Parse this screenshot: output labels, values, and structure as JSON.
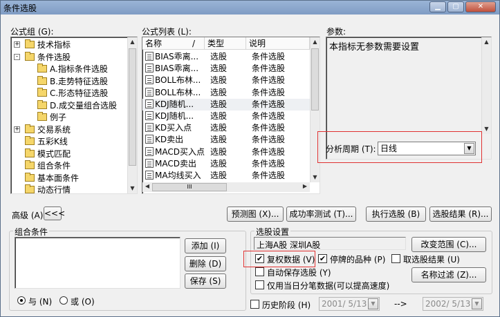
{
  "window": {
    "title": "条件选股"
  },
  "formula_group": {
    "label": "公式组 (G):",
    "tree": [
      {
        "label": "技术指标",
        "level": 0,
        "expander": "+"
      },
      {
        "label": "条件选股",
        "level": 0,
        "expander": "-"
      },
      {
        "label": "A.指标条件选股",
        "level": 1,
        "open": true
      },
      {
        "label": "B.走势特征选股",
        "level": 1
      },
      {
        "label": "C.形态特征选股",
        "level": 1
      },
      {
        "label": "D.成交量组合选股",
        "level": 1
      },
      {
        "label": "例子",
        "level": 1
      },
      {
        "label": "交易系统",
        "level": 0,
        "expander": "+"
      },
      {
        "label": "五彩K线",
        "level": 0
      },
      {
        "label": "模式匹配",
        "level": 0
      },
      {
        "label": "组合条件",
        "level": 0
      },
      {
        "label": "基本面条件",
        "level": 0
      },
      {
        "label": "动态行情",
        "level": 0
      }
    ]
  },
  "formula_list": {
    "label": "公式列表 (L):",
    "columns": {
      "name": "名称",
      "sep": "/",
      "type": "类型",
      "desc": "说明"
    },
    "rows": [
      {
        "name": "BIAS乖离...",
        "type": "选股",
        "desc": "条件选股"
      },
      {
        "name": "BIAS乖离...",
        "type": "选股",
        "desc": "条件选股"
      },
      {
        "name": "BOLL布林...",
        "type": "选股",
        "desc": "条件选股"
      },
      {
        "name": "BOLL布林...",
        "type": "选股",
        "desc": "条件选股"
      },
      {
        "name": "KDJ随机...",
        "type": "选股",
        "desc": "条件选股"
      },
      {
        "name": "KDJ随机...",
        "type": "选股",
        "desc": "条件选股"
      },
      {
        "name": "KD买入点",
        "type": "选股",
        "desc": "条件选股"
      },
      {
        "name": "KD卖出",
        "type": "选股",
        "desc": "条件选股"
      },
      {
        "name": "MACD买入点",
        "type": "选股",
        "desc": "条件选股"
      },
      {
        "name": "MACD卖出",
        "type": "选股",
        "desc": "条件选股"
      },
      {
        "name": "MA均线买入",
        "type": "选股",
        "desc": "条件选股"
      }
    ],
    "selected_row": 4,
    "hscroll_grip": "III"
  },
  "params": {
    "label": "参数:",
    "text": "本指标无参数需要设置",
    "period_label": "分析周期 (T):",
    "period_value": "日线"
  },
  "toolbar": {
    "advanced": "高级 (A)",
    "advanced_arrows": "<<<",
    "preview": "预测图 (X)...",
    "success_test": "成功率测试 (T)...",
    "run": "执行选股 (B)",
    "results": "选股结果 (R)..."
  },
  "combo_conditions": {
    "title": "组合条件",
    "add": "添加 (I)",
    "delete": "删除 (D)",
    "save": "保存 (S)",
    "and_label": "与 (N)",
    "or_label": "或 (O)",
    "logic": "and"
  },
  "stock_settings": {
    "title": "选股设置",
    "markets": "上海A股  深圳A股",
    "change_range": "改变范围 (C)...",
    "fuquan": {
      "label": "复权数据 (V)",
      "checked": true
    },
    "suspended": {
      "label": "停牌的品种 (P)",
      "checked": true
    },
    "pick_result": {
      "label": "取选股结果 (U)",
      "checked": false
    },
    "auto_save": {
      "label": "自动保存选股 (Y)",
      "checked": false
    },
    "only_today": {
      "label": "仅用当日分笔数据(可以提高速度)",
      "checked": false
    },
    "name_filter": "名称过滤 (Z)..."
  },
  "history": {
    "label": "历史阶段 (H)",
    "checked": false,
    "start": "2001/ 5/13",
    "arrow": "-->",
    "end": "2002/ 5/13"
  },
  "icons": {
    "check_mark": "✔",
    "dropdown": "▼",
    "up": "▲",
    "down": "▼",
    "left": "◀",
    "right": "▶"
  }
}
